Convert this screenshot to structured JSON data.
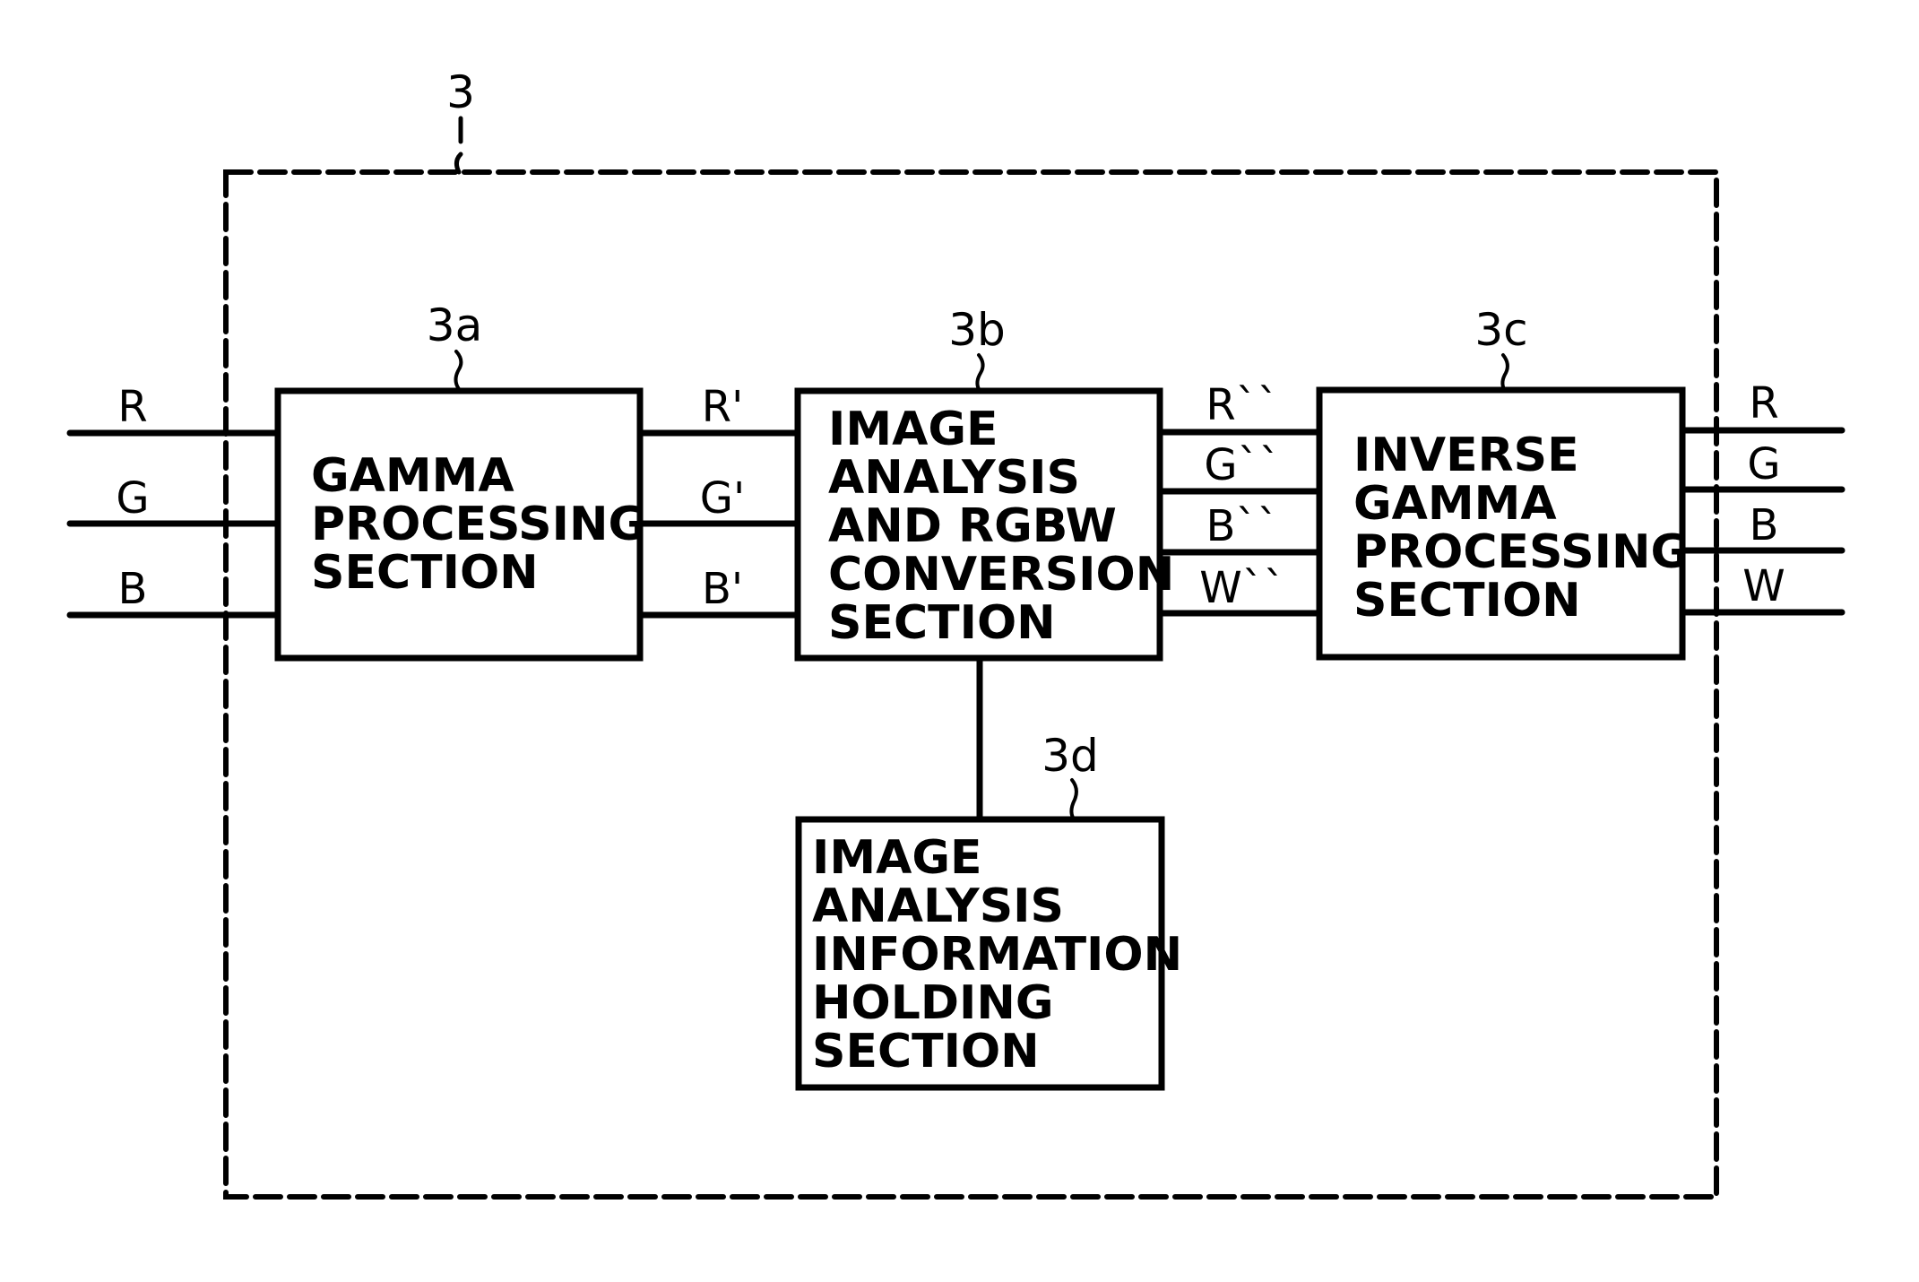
{
  "figure": {
    "container": {
      "ref": "3"
    },
    "blocks": [
      {
        "id": "3a",
        "ref": "3a",
        "lines": [
          "GAMMA",
          "PROCESSING",
          "SECTION"
        ]
      },
      {
        "id": "3b",
        "ref": "3b",
        "lines": [
          "IMAGE",
          "ANALYSIS",
          "AND RGBW",
          "CONVERSION",
          "SECTION"
        ]
      },
      {
        "id": "3c",
        "ref": "3c",
        "lines": [
          "INVERSE",
          "GAMMA",
          "PROCESSING",
          "SECTION"
        ]
      },
      {
        "id": "3d",
        "ref": "3d",
        "lines": [
          "IMAGE",
          "ANALYSIS",
          "INFORMATION",
          "HOLDING",
          "SECTION"
        ]
      }
    ],
    "signals": {
      "inputs": [
        "R",
        "G",
        "B"
      ],
      "gamma_outputs": [
        "R'",
        "G'",
        "B'"
      ],
      "conversion_outputs": [
        "R``",
        "G``",
        "B``",
        "W``"
      ],
      "outputs": [
        "R",
        "G",
        "B",
        "W"
      ]
    },
    "connections": [
      {
        "from": "inputs",
        "to": "3a"
      },
      {
        "from": "3a",
        "to": "3b"
      },
      {
        "from": "3b",
        "to": "3c"
      },
      {
        "from": "3c",
        "to": "outputs"
      },
      {
        "from": "3b",
        "to": "3d"
      }
    ]
  }
}
